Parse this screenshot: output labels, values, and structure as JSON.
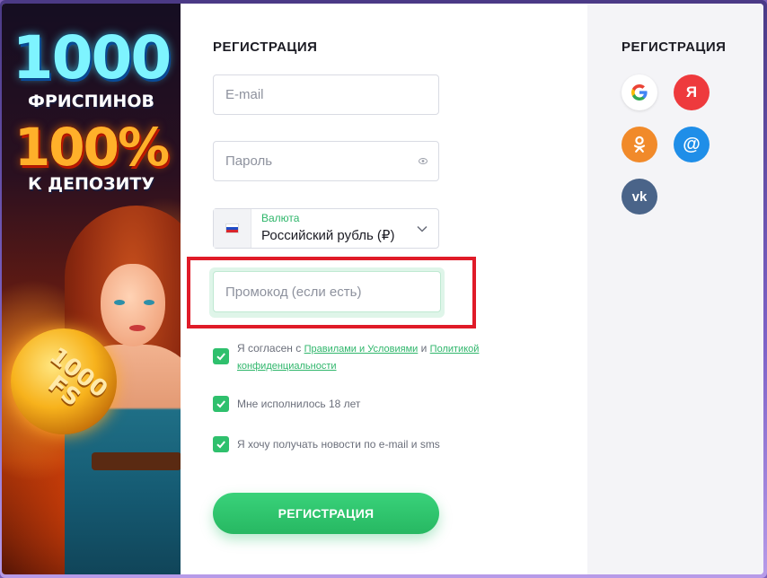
{
  "banner": {
    "headline_number": "1000",
    "headline_text": "ФРИСПИНОВ",
    "bonus_percent": "100%",
    "bonus_text": "К ДЕПОЗИТУ",
    "coin_text": "1000 FS"
  },
  "form": {
    "title": "РЕГИСТРАЦИЯ",
    "email_placeholder": "E-mail",
    "password_placeholder": "Пароль",
    "currency_label": "Валюта",
    "currency_value": "Российский рубль (₽)",
    "promo_placeholder": "Промокод (если есть)",
    "agree_prefix": "Я согласен с",
    "agree_rules_link": "Правилами и Условиями",
    "agree_and": "и",
    "agree_policy_link": "Политикой конфиденциальности",
    "age_text": "Мне исполнилось 18 лет",
    "news_text": "Я хочу получать новости по e-mail и sms",
    "submit_label": "РЕГИСТРАЦИЯ"
  },
  "social": {
    "title": "РЕГИСТРАЦИЯ",
    "buttons": [
      {
        "name": "google",
        "icon": "google-icon"
      },
      {
        "name": "yandex",
        "icon": "yandex-icon",
        "glyph": "Я"
      },
      {
        "name": "odnoklassniki",
        "icon": "odnoklassniki-icon"
      },
      {
        "name": "mail-ru",
        "icon": "at-icon",
        "glyph": "@"
      },
      {
        "name": "vk",
        "icon": "vk-icon",
        "glyph": "vk"
      }
    ]
  },
  "colors": {
    "accent_green": "#2fc06d",
    "highlight_red": "#e01b28",
    "yandex_red": "#ee3a3d",
    "ok_orange": "#f18a2a",
    "mail_blue": "#1f8ee8",
    "vk_blue": "#4a6489"
  }
}
